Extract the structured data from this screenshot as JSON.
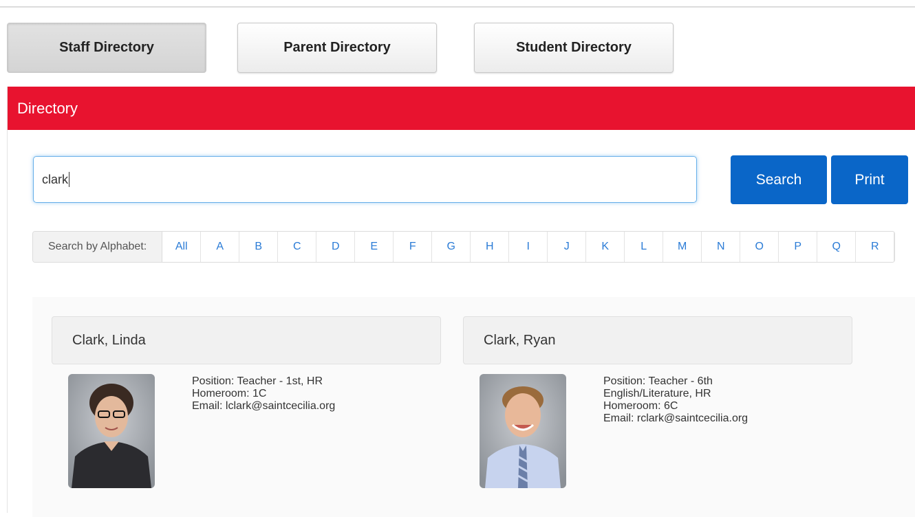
{
  "tabs": [
    {
      "label": "Staff Directory",
      "active": true
    },
    {
      "label": "Parent Directory",
      "active": false
    },
    {
      "label": "Student Directory",
      "active": false
    }
  ],
  "panel": {
    "title": "Directory"
  },
  "search": {
    "value": "clark",
    "search_label": "Search",
    "print_label": "Print"
  },
  "alphabet": {
    "label": "Search by Alphabet:",
    "letters": [
      "All",
      "A",
      "B",
      "C",
      "D",
      "E",
      "F",
      "G",
      "H",
      "I",
      "J",
      "K",
      "L",
      "M",
      "N",
      "O",
      "P",
      "Q",
      "R"
    ]
  },
  "results": [
    {
      "name": "Clark, Linda",
      "lines": [
        "Position: Teacher - 1st, HR",
        "Homeroom: 1C",
        "Email: lclark@saintcecilia.org"
      ]
    },
    {
      "name": "Clark, Ryan",
      "lines": [
        "Position: Teacher - 6th",
        "English/Literature, HR",
        "Homeroom: 6C",
        "Email: rclark@saintcecilia.org"
      ]
    }
  ],
  "colors": {
    "header": "#e8132f",
    "button": "#0a66c8",
    "link": "#2a7bd6"
  }
}
